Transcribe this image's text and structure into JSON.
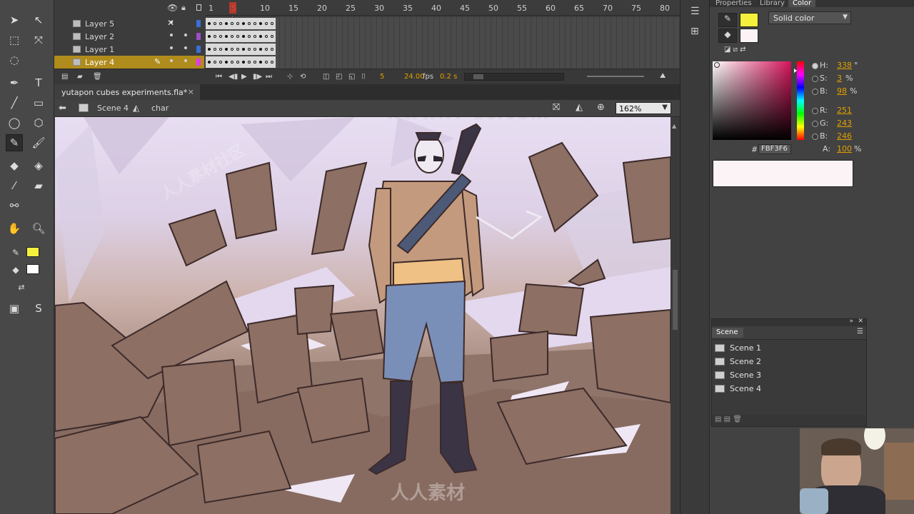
{
  "timeline": {
    "layers": [
      {
        "name": "Layer 5",
        "color": "#3b6fd6"
      },
      {
        "name": "Layer 2",
        "color": "#9b4fc9"
      },
      {
        "name": "Layer 1",
        "color": "#3b6fd6"
      },
      {
        "name": "Layer 4",
        "color": "#e33ce0"
      }
    ],
    "ruler": [
      "1",
      "5",
      "10",
      "15",
      "20",
      "25",
      "30",
      "35",
      "40",
      "45",
      "50",
      "55",
      "60",
      "65",
      "70",
      "75",
      "80"
    ],
    "current_frame": "5",
    "fps": "24.00",
    "fps_unit": "fps",
    "time": "0.2 s"
  },
  "document": {
    "tab_title": "yutapon cubes experiments.fla*",
    "close_glyph": "×"
  },
  "editbar": {
    "scene": "Scene 4",
    "symbol": "char",
    "zoom": "162%"
  },
  "color_panel": {
    "tabs": [
      "Properties",
      "Library",
      "Color"
    ],
    "fill_type": "Solid color",
    "stroke_color": "#f5f03c",
    "fill_color": "#fbf3f6",
    "H": "338",
    "H_unit": "°",
    "S": "3",
    "S_unit": "%",
    "B": "98",
    "B_unit": "%",
    "R": "251",
    "G": "243",
    "Bl": "246",
    "A": "100",
    "A_unit": "%",
    "hex": "FBF3F6",
    "hex_prefix": "#",
    "labels": {
      "H": "H:",
      "S": "S:",
      "B": "B:",
      "R": "R:",
      "G": "G:",
      "Bl": "B:",
      "A": "A:"
    }
  },
  "scene_panel": {
    "title": "Scene",
    "scenes": [
      "Scene 1",
      "Scene 2",
      "Scene 3",
      "Scene 4"
    ]
  },
  "watermark": {
    "top": "www.rr-sc.com",
    "bottom": "人人素材",
    "diagonal": "人人素材社区"
  },
  "toolbar_swatches": {
    "stroke": "#f5f03c",
    "fill": "#ffffff"
  }
}
